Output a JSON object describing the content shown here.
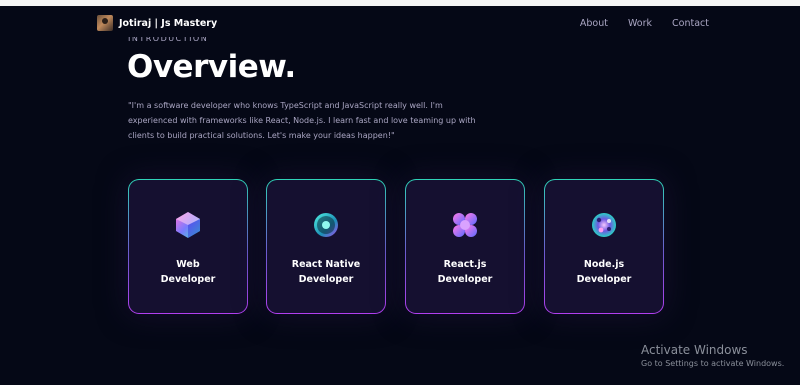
{
  "nav": {
    "brand": "Jotiraj | Js Mastery",
    "links": [
      "About",
      "Work",
      "Contact"
    ]
  },
  "hero": {
    "intro_label": "INTRODUCTION",
    "title": "Overview.",
    "description": "\"I'm a software developer who knows TypeScript and JavaScript really well. I'm experienced with frameworks like React, Node.js. I learn fast and love teaming up with clients to build practical solutions. Let's make your ideas happen!\""
  },
  "cards": [
    {
      "label": "Web\nDeveloper",
      "icon": "web-icon"
    },
    {
      "label": "React Native\nDeveloper",
      "icon": "mobile-icon"
    },
    {
      "label": "React.js\nDeveloper",
      "icon": "react-icon"
    },
    {
      "label": "Node.js\nDeveloper",
      "icon": "node-icon"
    }
  ],
  "watermark": {
    "title": "Activate Windows",
    "subtitle": "Go to Settings to activate Windows."
  },
  "colors": {
    "background": "#050816",
    "card_background": "#151030",
    "muted_text": "#aaa6c3",
    "border_top": "#2fd4b8",
    "border_bottom": "#b13ff0"
  }
}
